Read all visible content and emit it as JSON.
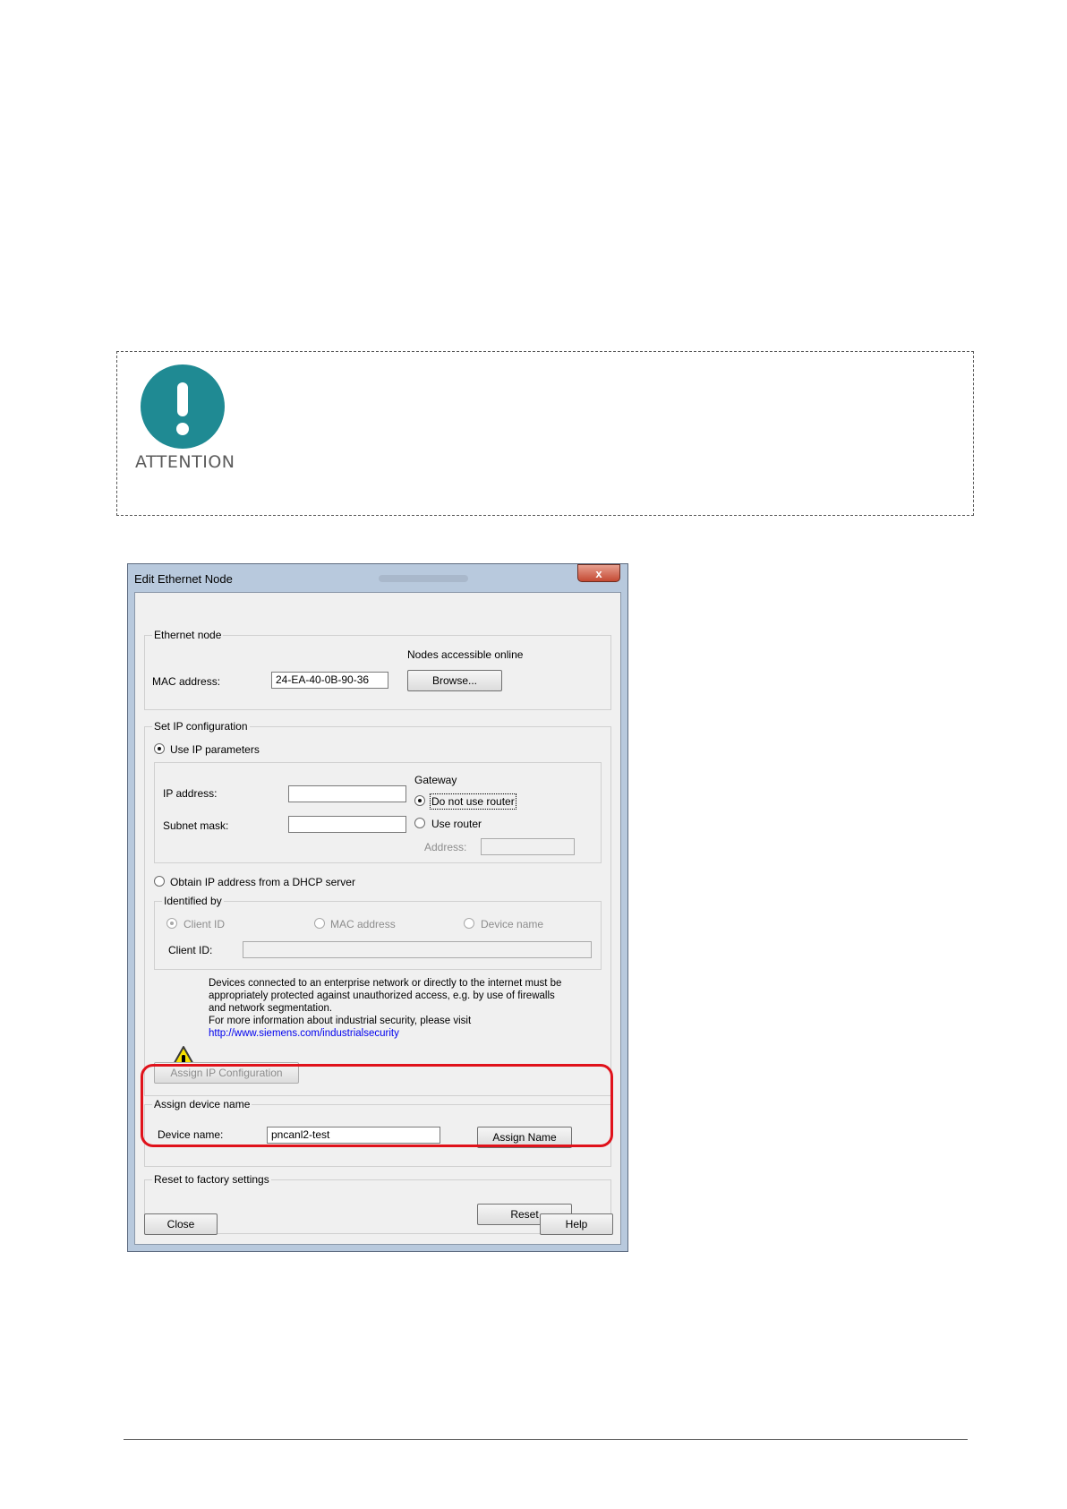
{
  "note": {
    "label": "ATTENTION",
    "icon": "exclamation-circle-icon",
    "color": "#1f8a93"
  },
  "dialog": {
    "title": "Edit Ethernet Node",
    "close_glyph": "x",
    "ethernet_node": {
      "group_label": "Ethernet node",
      "mac_label": "MAC address:",
      "mac_value": "24-EA-40-0B-90-36",
      "online_label": "Nodes accessible online",
      "browse_label": "Browse..."
    },
    "ip_config": {
      "group_label": "Set IP configuration",
      "use_ip_label": "Use IP parameters",
      "ip_label": "IP address:",
      "subnet_label": "Subnet mask:",
      "ip_value": "",
      "subnet_value": "",
      "gateway_label": "Gateway",
      "no_router_label": "Do not use router",
      "use_router_label": "Use router",
      "address_label": "Address:",
      "dhcp_label": "Obtain IP address from a DHCP server",
      "identified_label": "Identified by",
      "client_id_radio": "Client ID",
      "mac_radio": "MAC address",
      "device_name_radio": "Device name",
      "client_id_label": "Client ID:",
      "client_id_value": ""
    },
    "security": {
      "icon": "warning-triangle-icon",
      "lines": [
        "Devices connected to an enterprise network or directly to the internet must be",
        "appropriately protected against unauthorized access, e.g. by use of firewalls",
        "and network segmentation.",
        "For more information about industrial security, please visit"
      ],
      "link": "http://www.siemens.com/industrialsecurity"
    },
    "assign_ip_label": "Assign IP Configuration",
    "device_name": {
      "group_label": "Assign device name",
      "label": "Device name:",
      "value": "pncanl2-test",
      "assign_label": "Assign Name"
    },
    "reset": {
      "group_label": "Reset to factory settings",
      "reset_label": "Reset"
    },
    "close_label": "Close",
    "help_label": "Help"
  },
  "highlight_color": "#e0121b"
}
